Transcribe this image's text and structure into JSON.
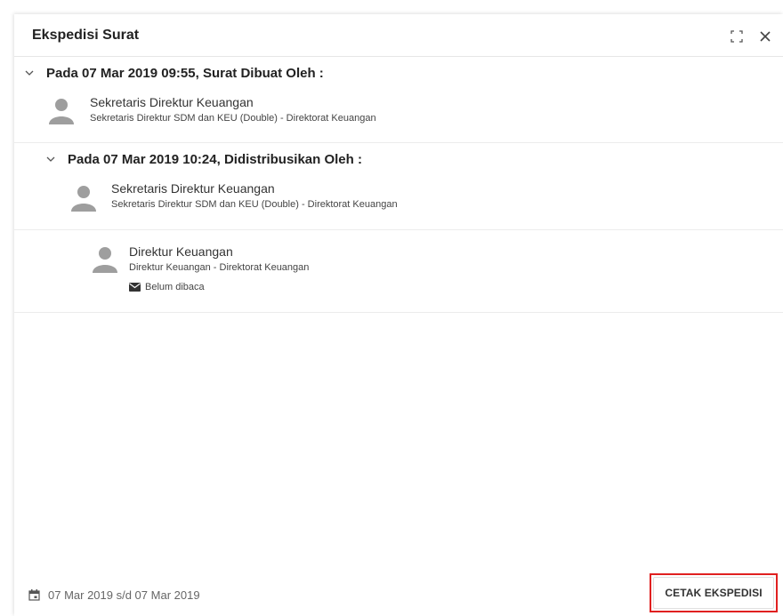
{
  "dialog": {
    "title": "Ekspedisi Surat"
  },
  "entries": [
    {
      "heading": "Pada 07 Mar 2019 09:55, Surat Dibuat Oleh :",
      "person_name": "Sekretaris Direktur Keuangan",
      "person_detail": "Sekretaris Direktur SDM dan KEU (Double) - Direktorat Keuangan"
    },
    {
      "heading": "Pada 07 Mar 2019 10:24, Didistribusikan Oleh :",
      "person_name": "Sekretaris Direktur Keuangan",
      "person_detail": "Sekretaris Direktur SDM dan KEU (Double) - Direktorat Keuangan"
    },
    {
      "person_name": "Direktur Keuangan",
      "person_detail": "Direktur Keuangan - Direktorat Keuangan",
      "status": "Belum dibaca"
    }
  ],
  "footer": {
    "date_range": "07 Mar 2019 s/d 07 Mar 2019",
    "print_label": "CETAK EKSPEDISI"
  },
  "icons": {
    "expand": "expand-icon",
    "close": "close-icon",
    "chevron": "chevron-down-icon",
    "avatar": "person-avatar-icon",
    "mail": "mail-icon",
    "calendar": "calendar-icon"
  },
  "colors": {
    "highlight_border": "#e02020",
    "avatar_gray": "#9e9e9e"
  }
}
